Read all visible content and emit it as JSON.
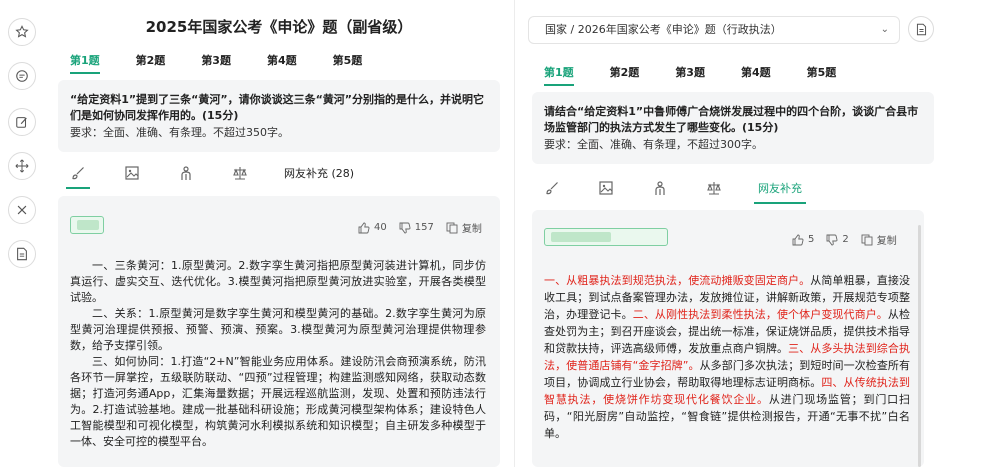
{
  "sidebar": {
    "icons": [
      "star-icon",
      "comment-icon",
      "edit-icon",
      "move-icon",
      "close-icon",
      "document-icon"
    ]
  },
  "left": {
    "title": "2025年国家公考《申论》题（副省级）",
    "tabs": [
      {
        "label": "第1题",
        "active": true
      },
      {
        "label": "第2题",
        "active": false
      },
      {
        "label": "第3题",
        "active": false
      },
      {
        "label": "第4题",
        "active": false
      },
      {
        "label": "第5题",
        "active": false
      }
    ],
    "question": {
      "text": "“给定资料1”提到了三条“黄河”，请你谈谈这三条“黄河”分别指的是什么，并说明它们是如何协同发挥作用的。(15分)",
      "requirement": "要求：全面、准确、有条理。不超过350字。"
    },
    "toolbar": {
      "supplement_label": "网友补充 (28)"
    },
    "answer": {
      "likes": "40",
      "dislikes": "157",
      "copy_label": "复制",
      "paragraphs": [
        "一、三条黄河：1.原型黄河。2.数字孪生黄河指把原型黄河装进计算机，同步仿真运行、虚实交互、迭代优化。3.模型黄河指把原型黄河放进实验室，开展各类模型试验。",
        "二、关系：1.原型黄河是数字孪生黄河和模型黄河的基础。2.数字孪生黄河为原型黄河治理提供预报、预警、预演、预案。3.模型黄河为原型黄河治理提供物理参数，给予支撑引领。",
        "三、如何协同：1.打造“2+N”智能业务应用体系。建设防汛会商预演系统，防汛各环节一屏掌控，五级联防联动、“四预”过程管理；构建监测感知网络，获取动态数据；打造河务通App，汇集海量数据；开展远程巡航监测，发现、处置和预防违法行为。2.打造试验基地。建成一批基础科研设施；形成黄河模型架构体系；建设特色人工智能模型和可视化模型，构筑黄河水利模拟系统和知识模型；自主研发多种模型于一体、安全可控的模型平台。"
      ]
    }
  },
  "right": {
    "breadcrumb": "国家 / 2026年国家公考《申论》题（行政执法）",
    "tabs": [
      {
        "label": "第1题",
        "active": true
      },
      {
        "label": "第2题",
        "active": false
      },
      {
        "label": "第3题",
        "active": false
      },
      {
        "label": "第4题",
        "active": false
      },
      {
        "label": "第5题",
        "active": false
      }
    ],
    "question": {
      "text": "请结合“给定资料1”中鲁师傅广合烧饼发展过程中的四个台阶，谈谈广合县市场监管部门的执法方式发生了哪些变化。(15分)",
      "requirement": "要求：全面、准确、有条理，不超过300字。"
    },
    "toolbar": {
      "supplement_label": "网友补充"
    },
    "answer": {
      "likes": "5",
      "dislikes": "2",
      "copy_label": "复制",
      "segments": [
        {
          "text": "一、从粗暴执法到规范执法，使流动摊贩变固定商户。",
          "red": true
        },
        {
          "text": "从简单粗暴，直接没收工具；到试点备案管理办法，发放摊位证，讲解新政策，开展规范专项整治，办理登记卡。",
          "red": false
        },
        {
          "text": "二、从刚性执法到柔性执法，使个体户变现代商户。",
          "red": true
        },
        {
          "text": "从检查处罚为主；到召开座谈会，提出统一标准，保证烧饼品质，提供技术指导和贷款扶持，评选高级师傅，发放重点商户铜牌。",
          "red": false
        },
        {
          "text": "三、从多头执法到综合执法，使普通店铺有“金字招牌”。",
          "red": true
        },
        {
          "text": "从多部门多次执法；到短时间一次检查所有项目，协调成立行业协会，帮助取得地理标志证明商标。",
          "red": false
        },
        {
          "text": "四、从传统执法到智慧执法，使烧饼作坊变现代化餐饮企业。",
          "red": true
        },
        {
          "text": "从进门现场监管；到门口扫码，“阳光厨房”自动监控，“智食链”提供检测报告，开通“无事不扰”白名单。",
          "red": false
        }
      ]
    }
  },
  "colors": {
    "accent": "#19a37a",
    "highlight_red": "#e0241b",
    "box_bg": "#f4f5f6"
  }
}
